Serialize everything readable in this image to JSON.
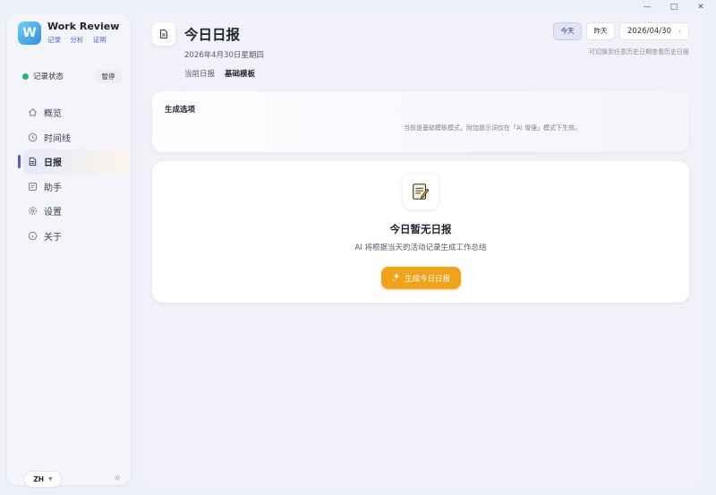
{
  "window": {
    "minimize": "—",
    "maximize": "□",
    "close": "✕"
  },
  "app": {
    "name": "Work Review",
    "logo_letter": "W",
    "subtitle": [
      "记录",
      "分析",
      "证明"
    ]
  },
  "recording": {
    "label": "记录状态",
    "pause_label": "暂停",
    "status_color": "#22b573"
  },
  "nav": {
    "items": [
      {
        "label": "概览",
        "icon": "home-icon"
      },
      {
        "label": "时间线",
        "icon": "clock-icon"
      },
      {
        "label": "日报",
        "icon": "document-icon",
        "active": true
      },
      {
        "label": "助手",
        "icon": "chat-icon"
      },
      {
        "label": "设置",
        "icon": "gear-icon"
      },
      {
        "label": "关于",
        "icon": "info-icon"
      }
    ]
  },
  "footer": {
    "lang": "ZH",
    "theme_icon": "sun-icon"
  },
  "header": {
    "title": "今日日报",
    "date": "2026年4月30日星期四",
    "tabs": [
      "当前日报",
      "基础模板"
    ],
    "today_label": "今天",
    "yesterday_label": "昨天",
    "date_value": "2026/04/30",
    "hint": "可切换到任意历史日期查看历史日报"
  },
  "options": {
    "title": "生成选项",
    "description": "当前是基础模板模式，附加提示词仅在「AI 增强」模式下生效。"
  },
  "empty": {
    "title": "今日暂无日报",
    "description": "AI 将根据当天的活动记录生成工作总结",
    "button_label": "生成今日日报"
  },
  "colors": {
    "accent": "#4a64c8",
    "button": "#f0a219"
  }
}
